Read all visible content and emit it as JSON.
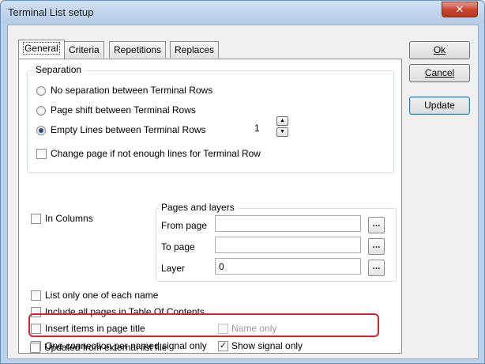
{
  "window": {
    "title": "Terminal List setup",
    "close_glyph": "✕"
  },
  "tabs": [
    {
      "label": "General",
      "active": true
    },
    {
      "label": "Criteria"
    },
    {
      "label": "Repetitions"
    },
    {
      "label": "Replaces"
    }
  ],
  "separation": {
    "title": "Separation",
    "radio_none": "No separation between Terminal Rows",
    "radio_page_shift": "Page shift between Terminal Rows",
    "radio_empty_lines": "Empty Lines between Terminal Rows",
    "empty_lines_value": "1",
    "change_page_label": "Change page if not enough lines for Terminal Row"
  },
  "in_columns_label": "In Columns",
  "pages_layers": {
    "title": "Pages and layers",
    "from_page_label": "From page",
    "from_page_value": "",
    "to_page_label": "To page",
    "to_page_value": "",
    "layer_label": "Layer",
    "layer_value": "0",
    "browse_glyph": "..."
  },
  "options": {
    "list_only_one": "List only one of each name",
    "include_all_pages": "Include all pages in Table Of Contents",
    "insert_items": "Insert items in page title",
    "name_only": "Name only",
    "one_connection": "One connection per named signal only",
    "show_signal_only": "Show signal only",
    "updated_external": "Updated from external list file"
  },
  "buttons": {
    "ok": "Ok",
    "cancel": "Cancel",
    "update": "Update"
  },
  "icons": {
    "spin_up": "▲",
    "spin_down": "▼",
    "check": "✓"
  },
  "colors": {
    "highlight": "#d9232d",
    "default_button_border": "#3c7fb1"
  }
}
